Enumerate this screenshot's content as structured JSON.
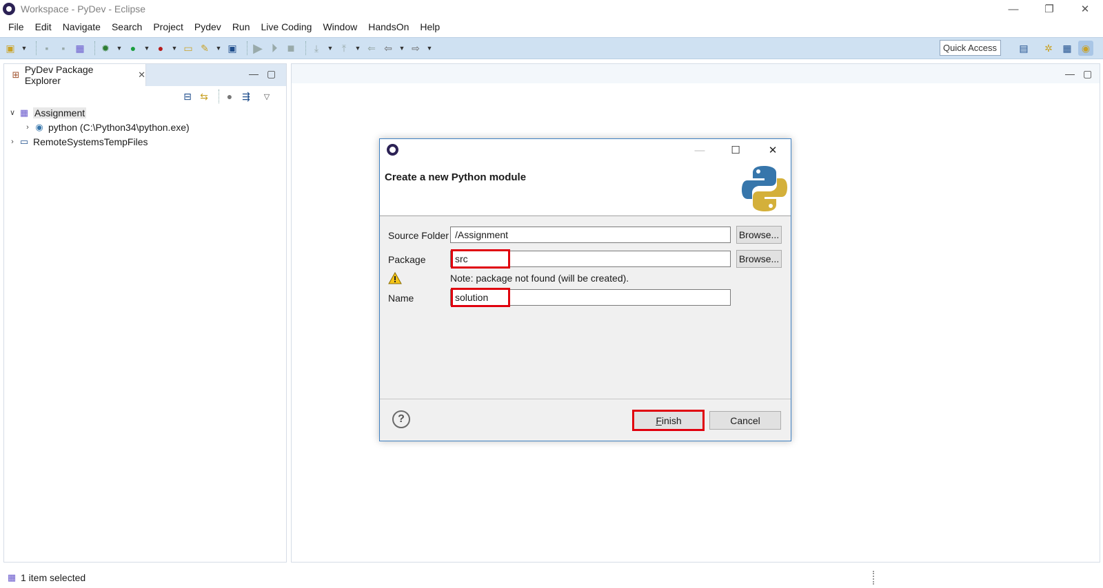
{
  "window": {
    "title": "Workspace - PyDev - Eclipse",
    "minimize": "—",
    "restore": "❐",
    "close": "✕"
  },
  "menubar": {
    "items": [
      "File",
      "Edit",
      "Navigate",
      "Search",
      "Project",
      "Pydev",
      "Run",
      "Live Coding",
      "Window",
      "HandsOn",
      "Help"
    ]
  },
  "toolbar": {
    "quick_access": "Quick Access"
  },
  "explorer": {
    "tab_label": "PyDev Package Explorer",
    "tree": [
      {
        "label": "Assignment",
        "expanded": true,
        "selected": true
      },
      {
        "label": "python  (C:\\Python34\\python.exe)",
        "expanded": false
      },
      {
        "label": "RemoteSystemsTempFiles",
        "expanded": false
      }
    ]
  },
  "statusbar": {
    "text": "1 item selected"
  },
  "dialog": {
    "heading": "Create a new Python module",
    "source_folder_label": "Source Folder",
    "source_folder_value": "/Assignment",
    "package_label": "Package",
    "package_value": "src",
    "browse_label": "Browse...",
    "note": "Note: package not found (will be created).",
    "name_label": "Name",
    "name_value": "solution",
    "help_glyph": "?",
    "finish_first": "F",
    "finish_rest": "inish",
    "cancel_label": "Cancel",
    "highlight_color": "#e0000d"
  }
}
